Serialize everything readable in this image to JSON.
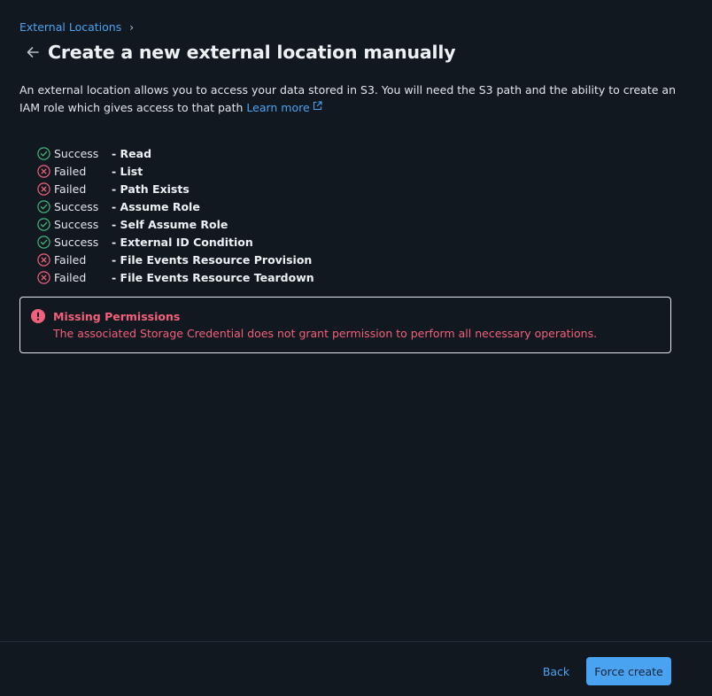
{
  "breadcrumb": {
    "parent": "External Locations",
    "separator": "›"
  },
  "header": {
    "title": "Create a new external location manually"
  },
  "description": {
    "text": "An external location allows you to access your data stored in S3. You will need the S3 path and the ability to create an IAM role which gives access to that path",
    "link_label": "Learn more"
  },
  "checks": [
    {
      "status": "Success",
      "name": "- Read"
    },
    {
      "status": "Failed",
      "name": "- List"
    },
    {
      "status": "Failed",
      "name": "- Path Exists"
    },
    {
      "status": "Success",
      "name": "- Assume Role"
    },
    {
      "status": "Success",
      "name": "- Self Assume Role"
    },
    {
      "status": "Success",
      "name": "- External ID Condition"
    },
    {
      "status": "Failed",
      "name": "- File Events Resource Provision"
    },
    {
      "status": "Failed",
      "name": "- File Events Resource Teardown"
    }
  ],
  "alert": {
    "title": "Missing Permissions",
    "message": "The associated Storage Credential does not grant permission to perform all necessary operations."
  },
  "footer": {
    "back_label": "Back",
    "force_create_label": "Force create"
  },
  "colors": {
    "success": "#3fb67a",
    "failed": "#f2607b",
    "accent": "#4aa3f0",
    "background": "#121820"
  },
  "icons": {
    "success": "check-circle-icon",
    "failed": "x-circle-icon",
    "alert": "exclamation-circle-icon",
    "back": "arrow-left-icon",
    "external": "external-link-icon"
  }
}
